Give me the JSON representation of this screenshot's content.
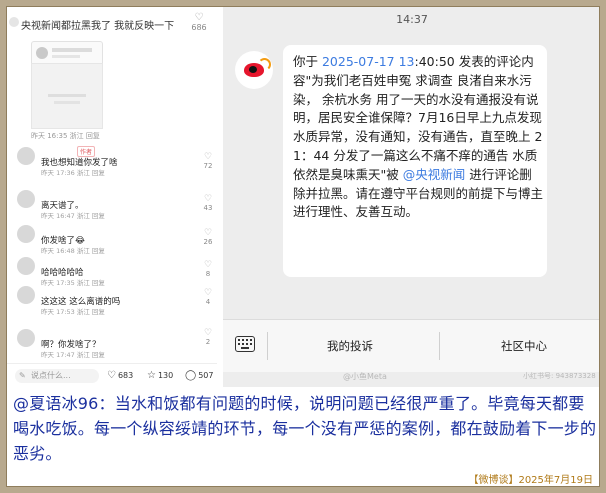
{
  "left_panel": {
    "header_text": "央视新闻都拉黑我了 我就反映一下",
    "header_likes": "686",
    "first_meta": "昨天 16:35 浙江  回复",
    "comments": [
      {
        "name": "",
        "tag": "作者",
        "text": "我也想知道你发了啥",
        "meta": "昨天 17:36 浙江  回复",
        "likes": "72"
      },
      {
        "name": "",
        "tag": "",
        "text": "离天谱了。",
        "meta": "昨天 16:47 浙江  回复",
        "likes": "43"
      },
      {
        "name": "",
        "tag": "",
        "text": "你发啥了😂",
        "meta": "昨天 16:48 浙江  回复",
        "likes": "26"
      },
      {
        "name": "",
        "tag": "",
        "text": "哈哈哈哈哈",
        "meta": "昨天 17:35 浙江  回复",
        "likes": "8"
      },
      {
        "name": "",
        "tag": "",
        "text": "这这这 这么离谱的吗",
        "meta": "昨天 17:53 浙江  回复",
        "likes": "4"
      },
      {
        "name": "",
        "tag": "",
        "text": "啊？你发啥了？",
        "meta": "昨天 17:47 浙江  回复",
        "likes": "2"
      }
    ],
    "bottom": {
      "input_placeholder": "说点什么...",
      "likes": "683",
      "stars": "130",
      "comments": "507"
    }
  },
  "right_panel": {
    "time": "14:37",
    "message_parts": {
      "p1": "你于 ",
      "date": "2025-07-17 13",
      "p2": ":40:50 发表的评论内容\"为我们老百姓申冤 求调查 良渚自来水污染， 余杭水务 用了一天的水没有通报没有说明，居民安全谁保障？7月16日早上九点发现水质异常，没有通知，没有通告，直至晚上 21：44 分发了一篇这么不痛不痒的通告 水质依然是臭味熏天\"被 ",
      "mention": "@央视新闻",
      "p3": " 进行评论删除并拉黑。请在遵守平台规则的前提下与博主进行理性、友善互动。"
    },
    "toolbar": {
      "complaint": "我的投诉",
      "community": "社区中心"
    },
    "watermark": "@小鱼Meta",
    "watermark_right": "小红书号: 943873328"
  },
  "caption": {
    "text": "@夏语冰96：当水和饭都有问题的时候，说明问题已经很严重了。毕竟每天都要喝水吃饭。每一个纵容绥靖的环节，每一个没有严惩的案例，都在鼓励着下一步的恶劣。",
    "source": "【微博谈】2025年7月19日"
  },
  "colors": {
    "frame": "#b8a98e",
    "caption_text": "#1a2f9e",
    "source_text": "#b07a18",
    "link": "#3c7be0",
    "weibo_red": "#e6162d"
  }
}
